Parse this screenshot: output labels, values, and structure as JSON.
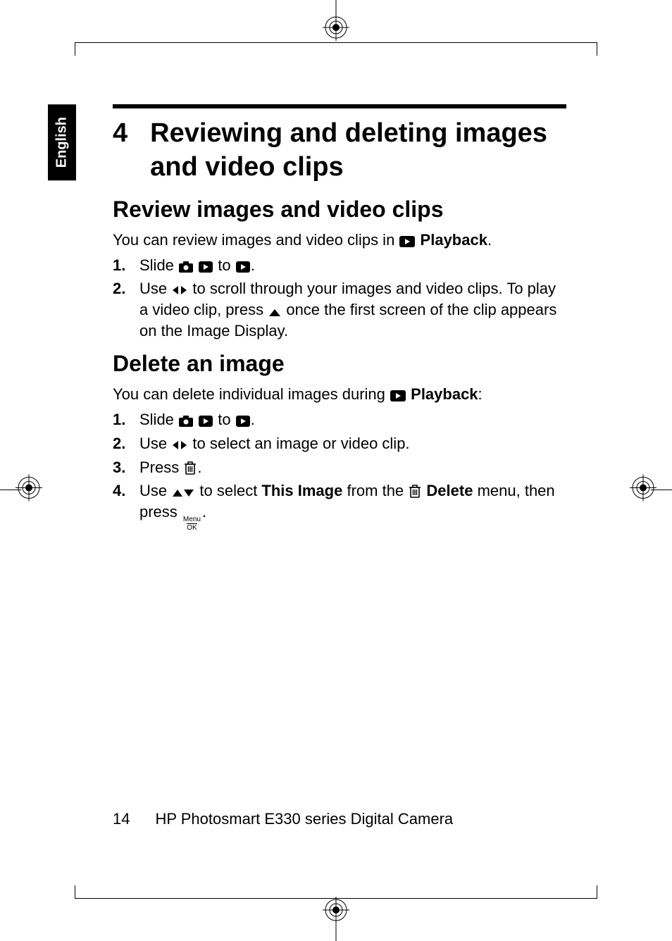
{
  "side_tab": "English",
  "chapter_number": "4",
  "chapter_title": "Reviewing and deleting images and video clips",
  "section1": {
    "heading": "Review images and video clips",
    "intro_a": "You can review images and video clips in ",
    "intro_b": " Playback",
    "intro_c": ".",
    "steps": [
      {
        "num": "1.",
        "a": "Slide ",
        "b": " to ",
        "c": "."
      },
      {
        "num": "2.",
        "a": "Use ",
        "b": " to scroll through your images and video clips. To play a video clip, press ",
        "c": " once the first screen of the clip appears on the Image Display."
      }
    ]
  },
  "section2": {
    "heading": "Delete an image",
    "intro_a": "You can delete individual images during ",
    "intro_b": " Playback",
    "intro_c": ":",
    "steps": [
      {
        "num": "1.",
        "a": "Slide ",
        "b": " to ",
        "c": "."
      },
      {
        "num": "2.",
        "a": "Use ",
        "b": " to select an image or video clip."
      },
      {
        "num": "3.",
        "a": "Press ",
        "b": "."
      },
      {
        "num": "4.",
        "a": "Use ",
        "b": " to select ",
        "c": "This Image",
        "d": " from the ",
        "e": " Delete",
        "f": " menu, then press ",
        "g": "."
      }
    ]
  },
  "footer": {
    "page": "14",
    "title": "HP Photosmart E330 series Digital Camera"
  },
  "menu_ok": {
    "menu": "Menu",
    "ok": "OK"
  }
}
